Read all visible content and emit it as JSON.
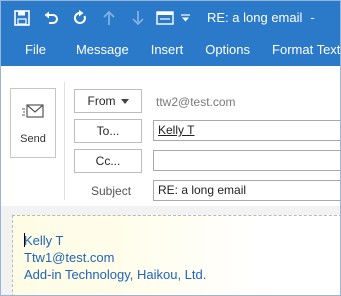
{
  "window": {
    "title": "RE: a long email",
    "title_suffix": "-"
  },
  "quick_access": {
    "icons": [
      "save-icon",
      "undo-icon",
      "redo-icon",
      "up-arrow-icon",
      "down-arrow-icon",
      "format-dropdown-icon"
    ]
  },
  "ribbon": {
    "tabs": [
      "File",
      "Message",
      "Insert",
      "Options",
      "Format Text"
    ]
  },
  "compose": {
    "send_label": "Send",
    "from_label": "From",
    "from_address": "ttw2@test.com",
    "to_label": "To...",
    "to_value": "Kelly T",
    "cc_label": "Cc...",
    "cc_value": "",
    "subject_label": "Subject",
    "subject_value": "RE: a long email"
  },
  "signature": {
    "lines": [
      "Kelly T",
      "Ttw1@test.com",
      "Add-in Technology, Haikou, Ltd."
    ]
  },
  "colors": {
    "accent": "#2b79c9",
    "signature_text": "#1f64b8"
  }
}
